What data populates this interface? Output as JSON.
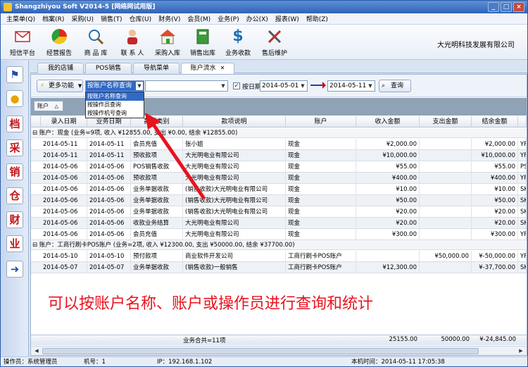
{
  "window": {
    "title": "Shangzhiyou Soft V2014-5 [网络网试用版]",
    "controls": [
      "_",
      "□",
      "×"
    ]
  },
  "menu": [
    "主菜单(Q)",
    "档案(R)",
    "采购(U)",
    "销售(T)",
    "仓库(U)",
    "财务(V)",
    "会员(M)",
    "业务(P)",
    "办公(X)",
    "报表(W)",
    "帮助(Z)"
  ],
  "toolbar": {
    "buttons": [
      {
        "label": "短信平台",
        "icon": "envelope-icon"
      },
      {
        "label": "经营报告",
        "icon": "chart-icon"
      },
      {
        "label": "商 品 库",
        "icon": "magnifier-icon"
      },
      {
        "label": "联 系 人",
        "icon": "person-icon"
      },
      {
        "label": "采购入库",
        "icon": "house-icon"
      },
      {
        "label": "销售出库",
        "icon": "notebook-icon"
      },
      {
        "label": "业务收款",
        "icon": "dollar-icon"
      },
      {
        "label": "售后维护",
        "icon": "tools-icon"
      }
    ],
    "company": "大光明科技发展有限公司"
  },
  "sidebar": {
    "icons": [
      "flag-icon",
      "bulb-icon",
      "档",
      "采",
      "销",
      "仓",
      "财",
      "业",
      "exit-icon"
    ]
  },
  "tabs": [
    {
      "label": "我的店铺"
    },
    {
      "label": "POS销售"
    },
    {
      "label": "导航菜单"
    },
    {
      "label": "账户流水",
      "close": "✕"
    }
  ],
  "query": {
    "more_label": "更多功能",
    "mode_selected": "按账户名称查询",
    "mode_options": [
      "按账户名称查询",
      "按操作员查询",
      "按操作机号查询"
    ],
    "by_date_label": "按日期",
    "date_from": "2014-05-01",
    "date_to": "2014-05-11",
    "query_label": "查询"
  },
  "group_chip": "账户",
  "columns": [
    "录入日期",
    "业务日期",
    "款项类别",
    "款项说明",
    "账户",
    "收入金额",
    "支出金额",
    "结余金额"
  ],
  "groups": [
    {
      "header": "⊟ 账户：现金 (业务=9项, 收入 ¥12855.00, 支出 ¥0.00, 结余 ¥12855.00)",
      "rows": [
        [
          "2014-05-11",
          "2014-05-11",
          "会员充值",
          "张小姐",
          "现金",
          "¥2,000.00",
          "",
          "¥2,000.00",
          "YF"
        ],
        [
          "2014-05-11",
          "2014-05-11",
          "预收款项",
          "大光明电业有限公司",
          "现金",
          "¥10,000.00",
          "",
          "¥10,000.00",
          "YF"
        ],
        [
          "2014-05-06",
          "2014-05-06",
          "POS销售收款",
          "大光明电业有限公司",
          "现金",
          "¥55.00",
          "",
          "¥55.00",
          "PS"
        ],
        [
          "2014-05-06",
          "2014-05-06",
          "预收款项",
          "大光明电业有限公司",
          "现金",
          "¥400.00",
          "",
          "¥400.00",
          "YF"
        ],
        [
          "2014-05-06",
          "2014-05-06",
          "业务单据收款",
          "(销售收款)大光明电业有限公司",
          "现金",
          "¥10.00",
          "",
          "¥10.00",
          "SK"
        ],
        [
          "2014-05-06",
          "2014-05-06",
          "业务单据收款",
          "(销售收款)大光明电业有限公司",
          "现金",
          "¥50.00",
          "",
          "¥50.00",
          "SK"
        ],
        [
          "2014-05-06",
          "2014-05-06",
          "业务单据收款",
          "(销售收款)大光明电业有限公司",
          "现金",
          "¥20.00",
          "",
          "¥20.00",
          "SK"
        ],
        [
          "2014-05-06",
          "2014-05-06",
          "收款业务结算",
          "大光明电业有限公司",
          "现金",
          "¥20.00",
          "",
          "¥20.00",
          "SK"
        ],
        [
          "2014-05-06",
          "2014-05-06",
          "会员充值",
          "大光明电业有限公司",
          "现金",
          "¥300.00",
          "",
          "¥300.00",
          "YF"
        ]
      ]
    },
    {
      "header": "⊟ 账户：工商行刷卡POS账户 (业务=2项, 收入 ¥12300.00, 支出 ¥50000.00, 结余 ¥37700.00)",
      "rows": [
        [
          "2014-05-10",
          "2014-05-10",
          "预付款项",
          "商业软件开发公司",
          "工商行刷卡POS账户",
          "",
          "¥50,000.00",
          "¥-50,000.00",
          "YF"
        ],
        [
          "2014-05-07",
          "2014-05-07",
          "业务单据收款",
          "(销售收款)一般销售",
          "工商行刷卡POS账户",
          "¥12,300.00",
          "",
          "¥-37,700.00",
          "SK"
        ]
      ]
    }
  ],
  "overlay_note": "可以按账户名称、账户或操作员进行查询和统计",
  "footer": {
    "count": "业务合共=11项",
    "income": "25155.00",
    "expense": "50000.00",
    "balance": "¥-24,845.00"
  },
  "status": {
    "operator": "操作员：系统管理员",
    "machine": "机号：1",
    "ip": "IP：192.168.1.102",
    "time": "本机时间：2014-05-11 17:05:38"
  },
  "accent_colors": {
    "title": "#2f63b8",
    "annotation": "#e8131e",
    "selection": "#3169c6"
  }
}
